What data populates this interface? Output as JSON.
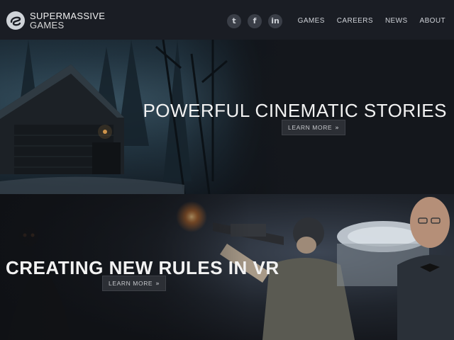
{
  "header": {
    "logo": {
      "line1": "SUPERMASSIVE",
      "line2": "GAMES"
    },
    "social": [
      {
        "name": "twitter-icon",
        "glyph": "t"
      },
      {
        "name": "facebook-icon",
        "glyph": "f"
      },
      {
        "name": "linkedin-icon",
        "glyph": "in"
      }
    ],
    "nav": [
      "GAMES",
      "CAREERS",
      "NEWS",
      "ABOUT"
    ]
  },
  "hero1": {
    "title": "POWERFUL CINEMATIC STORIES",
    "button_label": "LEARN MORE"
  },
  "hero2": {
    "title": "CREATING NEW RULES IN VR",
    "button_label": "LEARN MORE"
  },
  "colors": {
    "header_bg": "#1a1d24",
    "button_bg": "#2c2f35",
    "text": "#f2f2f2"
  }
}
